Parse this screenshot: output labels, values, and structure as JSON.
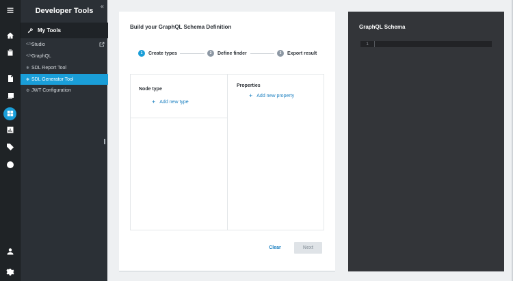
{
  "rail": {
    "items": [
      {
        "icon": "menu-icon"
      },
      {
        "icon": "home-icon"
      },
      {
        "icon": "clipboard-icon"
      },
      {
        "icon": "document-icon"
      },
      {
        "icon": "images-icon"
      },
      {
        "icon": "developer-tools-icon",
        "active": true
      },
      {
        "icon": "bar-chart-icon"
      },
      {
        "icon": "tag-icon"
      },
      {
        "icon": "compass-icon"
      },
      {
        "icon": "user-icon"
      },
      {
        "icon": "settings-icon"
      }
    ]
  },
  "sidebar": {
    "title": "Developer Tools",
    "collapse_glyph": "«",
    "section_label": "My Tools",
    "items": [
      {
        "bullet": "</>",
        "label": "Studio",
        "external": true
      },
      {
        "bullet": "</>",
        "label": "GraphQL"
      },
      {
        "bullet": "❄",
        "label": "SDL Report Tool"
      },
      {
        "bullet": "❄",
        "label": "SDL Generator Tool",
        "active": true
      },
      {
        "bullet": "⚙",
        "label": "JWT Configuration"
      }
    ]
  },
  "main": {
    "title": "Build your GraphQL Schema Definition",
    "steps": [
      {
        "number": "1",
        "label": "Create types",
        "state": "active"
      },
      {
        "number": "2",
        "label": "Define finder",
        "state": "inactive"
      },
      {
        "number": "3",
        "label": "Export result",
        "state": "inactive"
      }
    ],
    "node_type_label": "Node type",
    "add_type_label": "Add new type",
    "properties_label": "Properties",
    "add_property_label": "Add new property",
    "clear_label": "Clear",
    "next_label": "Next"
  },
  "schema": {
    "title": "GraphQL Schema",
    "line_number": "1"
  },
  "colors": {
    "accent": "#1a9ed8",
    "link": "#1a7fc0",
    "rail_bg": "#1f2326",
    "sidebar_bg": "#2b3036",
    "schema_bg": "#333539"
  }
}
